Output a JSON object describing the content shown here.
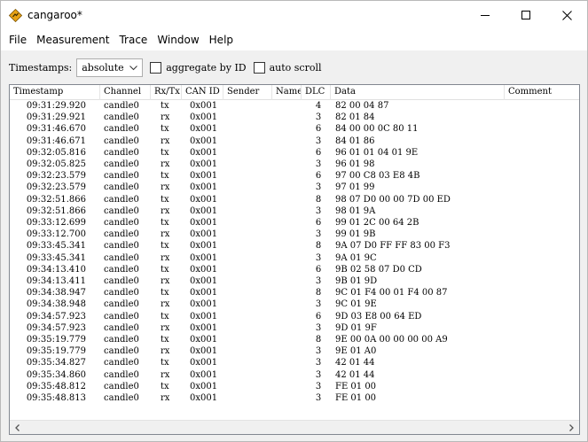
{
  "window": {
    "title": "cangaroo*",
    "icon": "cangaroo-diamond-icon",
    "accent": "#e8a317"
  },
  "menu": [
    "File",
    "Measurement",
    "Trace",
    "Window",
    "Help"
  ],
  "toolbar": {
    "timestamps_label": "Timestamps:",
    "timestamps_value": "absolute",
    "aggregate_label": "aggregate by ID",
    "autoscroll_label": "auto scroll"
  },
  "table": {
    "columns": [
      "Timestamp",
      "Channel",
      "Rx/Tx",
      "CAN ID",
      "Sender",
      "Name",
      "DLC",
      "Data",
      "Comment"
    ],
    "rows": [
      {
        "ts": "09:31:29.920",
        "ch": "candle0",
        "dir": "tx",
        "id": "0x001",
        "dlc": "4",
        "data": "82 00 04 87"
      },
      {
        "ts": "09:31:29.921",
        "ch": "candle0",
        "dir": "rx",
        "id": "0x001",
        "dlc": "3",
        "data": "82 01 84"
      },
      {
        "ts": "09:31:46.670",
        "ch": "candle0",
        "dir": "tx",
        "id": "0x001",
        "dlc": "6",
        "data": "84 00 00 0C 80 11"
      },
      {
        "ts": "09:31:46.671",
        "ch": "candle0",
        "dir": "rx",
        "id": "0x001",
        "dlc": "3",
        "data": "84 01 86"
      },
      {
        "ts": "09:32:05.816",
        "ch": "candle0",
        "dir": "tx",
        "id": "0x001",
        "dlc": "6",
        "data": "96 01 01 04 01 9E"
      },
      {
        "ts": "09:32:05.825",
        "ch": "candle0",
        "dir": "rx",
        "id": "0x001",
        "dlc": "3",
        "data": "96 01 98"
      },
      {
        "ts": "09:32:23.579",
        "ch": "candle0",
        "dir": "tx",
        "id": "0x001",
        "dlc": "6",
        "data": "97 00 C8 03 E8 4B"
      },
      {
        "ts": "09:32:23.579",
        "ch": "candle0",
        "dir": "rx",
        "id": "0x001",
        "dlc": "3",
        "data": "97 01 99"
      },
      {
        "ts": "09:32:51.866",
        "ch": "candle0",
        "dir": "tx",
        "id": "0x001",
        "dlc": "8",
        "data": "98 07 D0 00 00 7D 00 ED"
      },
      {
        "ts": "09:32:51.866",
        "ch": "candle0",
        "dir": "rx",
        "id": "0x001",
        "dlc": "3",
        "data": "98 01 9A"
      },
      {
        "ts": "09:33:12.699",
        "ch": "candle0",
        "dir": "tx",
        "id": "0x001",
        "dlc": "6",
        "data": "99 01 2C 00 64 2B"
      },
      {
        "ts": "09:33:12.700",
        "ch": "candle0",
        "dir": "rx",
        "id": "0x001",
        "dlc": "3",
        "data": "99 01 9B"
      },
      {
        "ts": "09:33:45.341",
        "ch": "candle0",
        "dir": "tx",
        "id": "0x001",
        "dlc": "8",
        "data": "9A 07 D0 FF FF 83 00 F3"
      },
      {
        "ts": "09:33:45.341",
        "ch": "candle0",
        "dir": "rx",
        "id": "0x001",
        "dlc": "3",
        "data": "9A 01 9C"
      },
      {
        "ts": "09:34:13.410",
        "ch": "candle0",
        "dir": "tx",
        "id": "0x001",
        "dlc": "6",
        "data": "9B 02 58 07 D0 CD"
      },
      {
        "ts": "09:34:13.411",
        "ch": "candle0",
        "dir": "rx",
        "id": "0x001",
        "dlc": "3",
        "data": "9B 01 9D"
      },
      {
        "ts": "09:34:38.947",
        "ch": "candle0",
        "dir": "tx",
        "id": "0x001",
        "dlc": "8",
        "data": "9C 01 F4 00 01 F4 00 87"
      },
      {
        "ts": "09:34:38.948",
        "ch": "candle0",
        "dir": "rx",
        "id": "0x001",
        "dlc": "3",
        "data": "9C 01 9E"
      },
      {
        "ts": "09:34:57.923",
        "ch": "candle0",
        "dir": "tx",
        "id": "0x001",
        "dlc": "6",
        "data": "9D 03 E8 00 64 ED"
      },
      {
        "ts": "09:34:57.923",
        "ch": "candle0",
        "dir": "rx",
        "id": "0x001",
        "dlc": "3",
        "data": "9D 01 9F"
      },
      {
        "ts": "09:35:19.779",
        "ch": "candle0",
        "dir": "tx",
        "id": "0x001",
        "dlc": "8",
        "data": "9E 00 0A 00 00 00 00 A9"
      },
      {
        "ts": "09:35:19.779",
        "ch": "candle0",
        "dir": "rx",
        "id": "0x001",
        "dlc": "3",
        "data": "9E 01 A0"
      },
      {
        "ts": "09:35:34.827",
        "ch": "candle0",
        "dir": "tx",
        "id": "0x001",
        "dlc": "3",
        "data": "42 01 44"
      },
      {
        "ts": "09:35:34.860",
        "ch": "candle0",
        "dir": "rx",
        "id": "0x001",
        "dlc": "3",
        "data": "42 01 44"
      },
      {
        "ts": "09:35:48.812",
        "ch": "candle0",
        "dir": "tx",
        "id": "0x001",
        "dlc": "3",
        "data": "FE 01 00"
      },
      {
        "ts": "09:35:48.813",
        "ch": "candle0",
        "dir": "rx",
        "id": "0x001",
        "dlc": "3",
        "data": "FE 01 00"
      }
    ]
  }
}
